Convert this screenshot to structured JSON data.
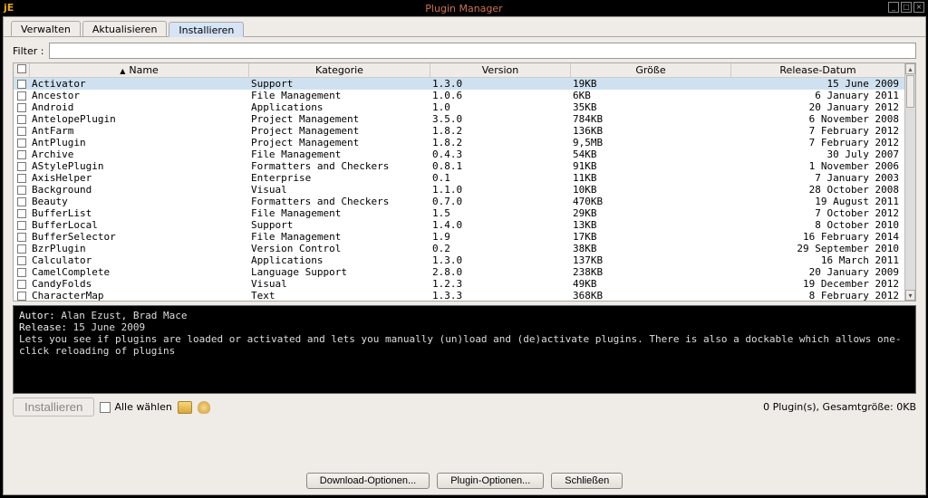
{
  "window": {
    "title": "Plugin Manager"
  },
  "tabs": [
    {
      "label": "Verwalten",
      "active": false
    },
    {
      "label": "Aktualisieren",
      "active": false
    },
    {
      "label": "Installieren",
      "active": true
    }
  ],
  "filter": {
    "label": "Filter :",
    "value": ""
  },
  "columns": {
    "name": "Name",
    "category": "Kategorie",
    "version": "Version",
    "size": "Größe",
    "date": "Release-Datum"
  },
  "rows": [
    {
      "name": "Activator",
      "category": "Support",
      "version": "1.3.0",
      "size": "19KB",
      "date": "15 June 2009",
      "selected": true
    },
    {
      "name": "Ancestor",
      "category": "File Management",
      "version": "1.0.6",
      "size": "6KB",
      "date": "6 January 2011"
    },
    {
      "name": "Android",
      "category": "Applications",
      "version": "1.0",
      "size": "35KB",
      "date": "20 January 2012"
    },
    {
      "name": "AntelopePlugin",
      "category": "Project Management",
      "version": "3.5.0",
      "size": "784KB",
      "date": "6 November 2008"
    },
    {
      "name": "AntFarm",
      "category": "Project Management",
      "version": "1.8.2",
      "size": "136KB",
      "date": "7 February 2012"
    },
    {
      "name": "AntPlugin",
      "category": "Project Management",
      "version": "1.8.2",
      "size": "9,5MB",
      "date": "7 February 2012"
    },
    {
      "name": "Archive",
      "category": "File Management",
      "version": "0.4.3",
      "size": "54KB",
      "date": "30 July 2007"
    },
    {
      "name": "AStylePlugin",
      "category": "Formatters and Checkers",
      "version": "0.8.1",
      "size": "91KB",
      "date": "1 November 2006"
    },
    {
      "name": "AxisHelper",
      "category": "Enterprise",
      "version": "0.1",
      "size": "11KB",
      "date": "7 January 2003"
    },
    {
      "name": "Background",
      "category": "Visual",
      "version": "1.1.0",
      "size": "10KB",
      "date": "28 October 2008"
    },
    {
      "name": "Beauty",
      "category": "Formatters and Checkers",
      "version": "0.7.0",
      "size": "470KB",
      "date": "19 August 2011"
    },
    {
      "name": "BufferList",
      "category": "File Management",
      "version": "1.5",
      "size": "29KB",
      "date": "7 October 2012"
    },
    {
      "name": "BufferLocal",
      "category": "Support",
      "version": "1.4.0",
      "size": "13KB",
      "date": "8 October 2010"
    },
    {
      "name": "BufferSelector",
      "category": "File Management",
      "version": "1.9",
      "size": "17KB",
      "date": "16 February 2014"
    },
    {
      "name": "BzrPlugin",
      "category": "Version Control",
      "version": "0.2",
      "size": "38KB",
      "date": "29 September 2010"
    },
    {
      "name": "Calculator",
      "category": "Applications",
      "version": "1.3.0",
      "size": "137KB",
      "date": "16 March 2011"
    },
    {
      "name": "CamelComplete",
      "category": "Language Support",
      "version": "2.8.0",
      "size": "238KB",
      "date": "20 January 2009"
    },
    {
      "name": "CandyFolds",
      "category": "Visual",
      "version": "1.2.3",
      "size": "49KB",
      "date": "19 December 2012"
    },
    {
      "name": "CharacterMap",
      "category": "Text",
      "version": "1.3.3",
      "size": "368KB",
      "date": "8 February 2012"
    }
  ],
  "detail": {
    "author_label": "Autor:",
    "author_value": "Alan Ezust, Brad Mace",
    "release_label": "Release:",
    "release_value": "15 June 2009",
    "description": "Lets you see if plugins are loaded or activated and lets you manually (un)load and (de)activate plugins. There is also a dockable which allows one-click reloading of plugins"
  },
  "bottom": {
    "install": "Installieren",
    "select_all": "Alle wählen",
    "status": "0 Plugin(s), Gesamtgröße: 0KB"
  },
  "buttons": {
    "download": "Download-Optionen...",
    "plugin": "Plugin-Optionen...",
    "close": "Schließen"
  }
}
